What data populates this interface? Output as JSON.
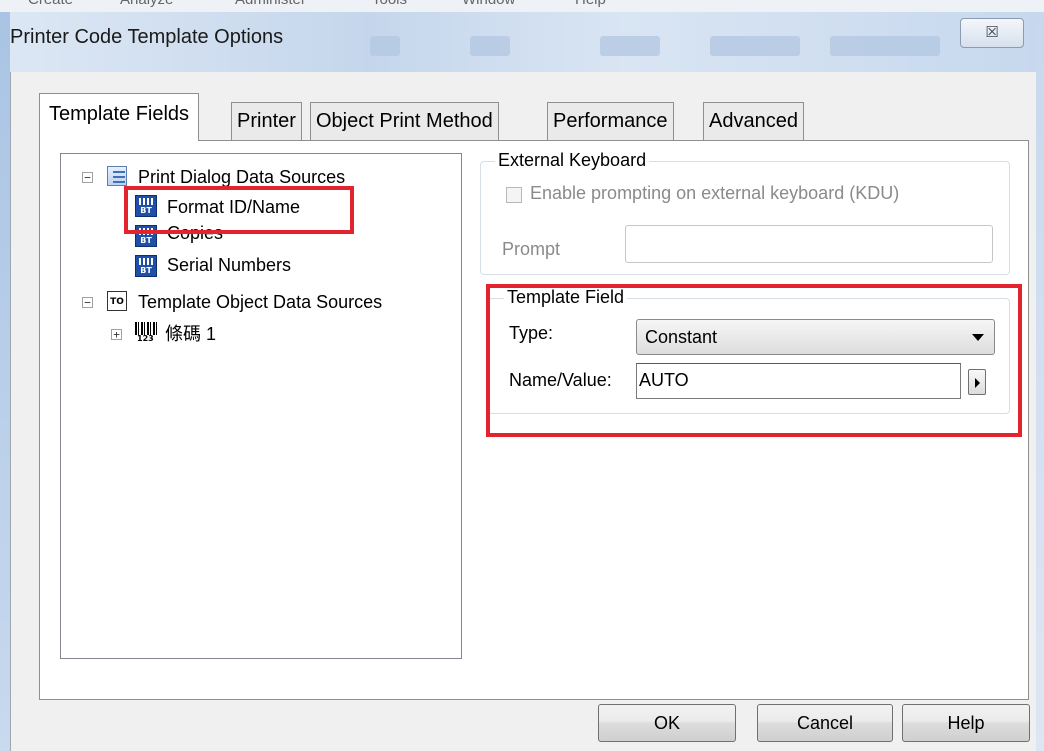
{
  "background": {
    "menubar_items": [
      "Create",
      "Analyze",
      "Administer",
      "Tools",
      "Window",
      "Help"
    ]
  },
  "dialog": {
    "title": "Printer Code Template Options",
    "close_glyph": "☒"
  },
  "tabs": [
    {
      "label": "Template Fields",
      "active": true
    },
    {
      "label": "Printer",
      "active": false
    },
    {
      "label": "Object Print Method",
      "active": false
    },
    {
      "label": "Performance",
      "active": false
    },
    {
      "label": "Advanced",
      "active": false
    }
  ],
  "tree": {
    "print_dialog_sources": {
      "label": "Print Dialog Data Sources",
      "expander": "−",
      "children": [
        "Format ID/Name",
        "Copies",
        "Serial Numbers"
      ]
    },
    "template_object_sources": {
      "label": "Template Object Data Sources",
      "expander": "−",
      "icon_text": "TO",
      "children": [
        {
          "label": "條碼 1",
          "expander": "+",
          "icon_text": "123"
        }
      ]
    },
    "bt_icon_text": "BT"
  },
  "external_keyboard": {
    "legend": "External Keyboard",
    "checkbox_label": "Enable prompting on external keyboard (KDU)",
    "checkbox_checked": false,
    "prompt_label": "Prompt",
    "prompt_value": ""
  },
  "template_field": {
    "legend": "Template Field",
    "type_label": "Type:",
    "type_value": "Constant",
    "name_label": "Name/Value:",
    "name_value": "AUTO"
  },
  "buttons": {
    "ok": "OK",
    "cancel": "Cancel",
    "help": "Help"
  },
  "colors": {
    "highlight": "#e3232e",
    "dialog_bg": "#f0f0f0",
    "titlebar": "#c5d6ec"
  }
}
